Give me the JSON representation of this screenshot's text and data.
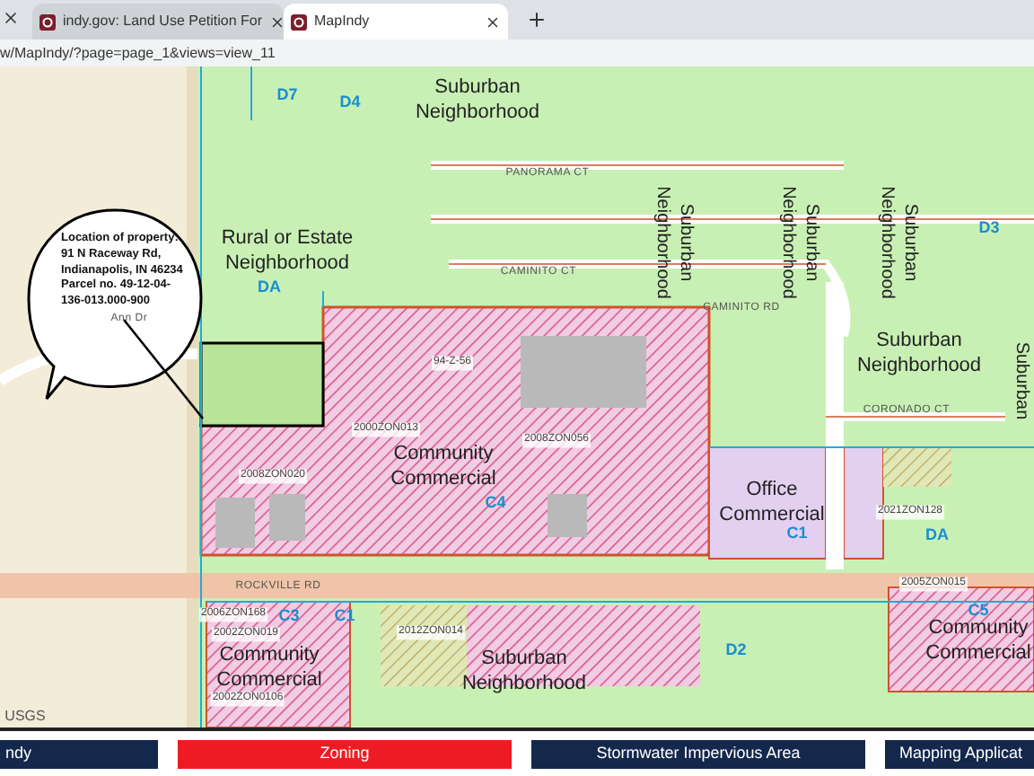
{
  "browser": {
    "tabs": [
      {
        "title": "indy.gov: Land Use Petition For",
        "selected": false
      },
      {
        "title": "MapIndy",
        "selected": true
      }
    ],
    "url": "w/MapIndy/?page=page_1&views=view_11"
  },
  "map": {
    "callout": "Location of property: 91 N Raceway Rd, Indianapolis, IN 46234 Parcel no. 49-12-04-136-013.000-900",
    "labels": [
      {
        "text": "D7",
        "kind": "district"
      },
      {
        "text": "D4",
        "kind": "district"
      },
      {
        "text": "Suburban Neighborhood",
        "kind": "zone"
      },
      {
        "text": "PANORAMA CT",
        "kind": "street"
      },
      {
        "text": "Suburban Neighborhood",
        "kind": "vertical"
      },
      {
        "text": "Suburban Neighborhood",
        "kind": "vertical"
      },
      {
        "text": "Suburban Neighborhood",
        "kind": "vertical"
      },
      {
        "text": "Suburban",
        "kind": "vertical"
      },
      {
        "text": "Rural or Estate Neighborhood",
        "kind": "zone"
      },
      {
        "text": "DA",
        "kind": "district"
      },
      {
        "text": "CAMINITO CT",
        "kind": "street"
      },
      {
        "text": "CAMINITO RD",
        "kind": "street"
      },
      {
        "text": "D3",
        "kind": "district"
      },
      {
        "text": "Suburban Neighborhood",
        "kind": "zone"
      },
      {
        "text": "CORONADO CT",
        "kind": "street"
      },
      {
        "text": "94-Z-56",
        "kind": "case"
      },
      {
        "text": "2000ZON013",
        "kind": "case"
      },
      {
        "text": "2008ZON056",
        "kind": "case"
      },
      {
        "text": "2008ZON020",
        "kind": "case"
      },
      {
        "text": "Community Commercial",
        "kind": "zone"
      },
      {
        "text": "C4",
        "kind": "district"
      },
      {
        "text": "Office Commercial",
        "kind": "zone"
      },
      {
        "text": "C1",
        "kind": "district"
      },
      {
        "text": "2021ZON128",
        "kind": "case"
      },
      {
        "text": "DA",
        "kind": "district"
      },
      {
        "text": "ROCKVILLE RD",
        "kind": "street"
      },
      {
        "text": "2005ZON015",
        "kind": "case"
      },
      {
        "text": "2006ZON168",
        "kind": "case"
      },
      {
        "text": "C3",
        "kind": "district"
      },
      {
        "text": "C1",
        "kind": "district"
      },
      {
        "text": "2002ZON019",
        "kind": "case"
      },
      {
        "text": "Community Commercial",
        "kind": "zone"
      },
      {
        "text": "2012ZON014",
        "kind": "case"
      },
      {
        "text": "Suburban Neighborhood",
        "kind": "zone"
      },
      {
        "text": "D2",
        "kind": "district"
      },
      {
        "text": "C5",
        "kind": "district"
      },
      {
        "text": "Community Commercial",
        "kind": "zone"
      },
      {
        "text": "2002ZON0106",
        "kind": "case"
      },
      {
        "text": "Ann Dr",
        "kind": "street"
      },
      {
        "text": "USGS",
        "kind": "credit"
      }
    ]
  },
  "nav_buttons": [
    {
      "label": "ndy",
      "selected": false
    },
    {
      "label": "Zoning",
      "selected": true
    },
    {
      "label": "Stormwater Impervious Area",
      "selected": false
    },
    {
      "label": "Mapping Applicat",
      "selected": false
    }
  ]
}
